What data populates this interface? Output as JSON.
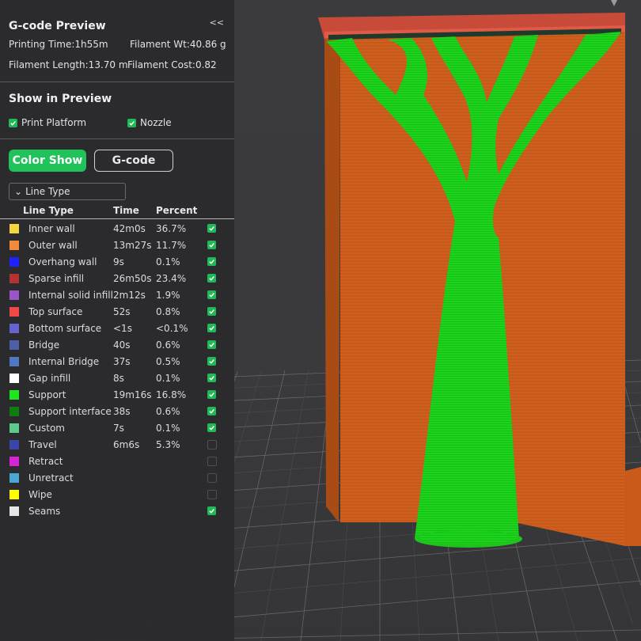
{
  "panel": {
    "title": "G-code Preview",
    "collapse_label": "<<",
    "stats": {
      "printing_time": "Printing Time:1h55m",
      "filament_wt": "Filament Wt:40.86 g",
      "filament_length": "Filament Length:13.70 m",
      "filament_cost": "Filament Cost:0.82"
    },
    "show_in_preview": {
      "title": "Show in Preview",
      "print_platform": "Print Platform",
      "nozzle": "Nozzle",
      "print_platform_checked": true,
      "nozzle_checked": true
    },
    "buttons": {
      "color_show": "Color Show",
      "gcode": "G-code"
    },
    "dropdown": {
      "chevron": "⌄",
      "selected": "Line Type"
    },
    "table": {
      "headers": {
        "line_type": "Line Type",
        "time": "Time",
        "percent": "Percent"
      },
      "rows": [
        {
          "label": "Inner wall",
          "time": "42m0s",
          "percent": "36.7%",
          "color": "#f5d442",
          "checked": true
        },
        {
          "label": "Outer wall",
          "time": "13m27s",
          "percent": "11.7%",
          "color": "#f08a3c",
          "checked": true
        },
        {
          "label": "Overhang wall",
          "time": "9s",
          "percent": "0.1%",
          "color": "#2121ff",
          "checked": true
        },
        {
          "label": "Sparse infill",
          "time": "26m50s",
          "percent": "23.4%",
          "color": "#b33232",
          "checked": true
        },
        {
          "label": "Internal solid infill",
          "time": "2m12s",
          "percent": "1.9%",
          "color": "#9a55c9",
          "checked": true
        },
        {
          "label": "Top surface",
          "time": "52s",
          "percent": "0.8%",
          "color": "#ef4848",
          "checked": true
        },
        {
          "label": "Bottom surface",
          "time": "<1s",
          "percent": "<0.1%",
          "color": "#6662d0",
          "checked": true
        },
        {
          "label": "Bridge",
          "time": "40s",
          "percent": "0.6%",
          "color": "#4d5fa6",
          "checked": true
        },
        {
          "label": "Internal Bridge",
          "time": "37s",
          "percent": "0.5%",
          "color": "#4e79c2",
          "checked": true
        },
        {
          "label": "Gap infill",
          "time": "8s",
          "percent": "0.1%",
          "color": "#ffffff",
          "checked": true
        },
        {
          "label": "Support",
          "time": "19m16s",
          "percent": "16.8%",
          "color": "#1ee61e",
          "checked": true
        },
        {
          "label": "Support interface",
          "time": "38s",
          "percent": "0.6%",
          "color": "#0f7d0f",
          "checked": true
        },
        {
          "label": "Custom",
          "time": "7s",
          "percent": "0.1%",
          "color": "#5ec98d",
          "checked": true
        },
        {
          "label": "Travel",
          "time": "6m6s",
          "percent": "5.3%",
          "color": "#3b45a8",
          "checked": false
        },
        {
          "label": "Retract",
          "time": "",
          "percent": "",
          "color": "#d524d5",
          "checked": false
        },
        {
          "label": "Unretract",
          "time": "",
          "percent": "",
          "color": "#4aa7d0",
          "checked": false
        },
        {
          "label": "Wipe",
          "time": "",
          "percent": "",
          "color": "#ffff00",
          "checked": false
        },
        {
          "label": "Seams",
          "time": "",
          "percent": "",
          "color": "#e6e6e6",
          "checked": true
        }
      ]
    }
  },
  "colors": {
    "accent": "#20c25a",
    "panel_bg": "#2b2b2e",
    "viewport_bg": "#3a3a3c",
    "support_green": "#1fd21f",
    "model_orange": "#cc5e1a"
  }
}
